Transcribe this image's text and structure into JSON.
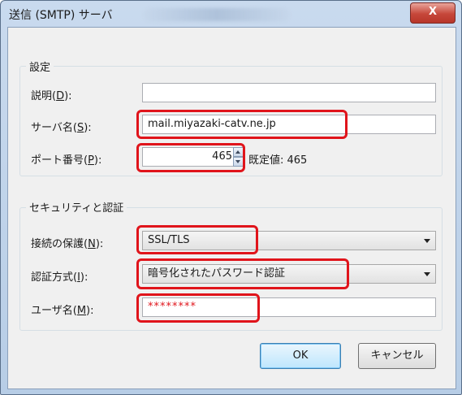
{
  "window": {
    "title": "送信 (SMTP) サーバ",
    "close_label": "X"
  },
  "settings": {
    "group_label": "設定",
    "description": {
      "label": "説明(",
      "mnemonic": "D",
      "suffix": "):",
      "value": ""
    },
    "server": {
      "label": "サーバ名(",
      "mnemonic": "S",
      "suffix": "):",
      "value": "mail.miyazaki-catv.ne.jp"
    },
    "port": {
      "label": "ポート番号(",
      "mnemonic": "P",
      "suffix": "):",
      "value": "465",
      "default_text": "既定値:  465"
    }
  },
  "security": {
    "group_label": "セキュリティと認証",
    "connection": {
      "label": "接続の保護(",
      "mnemonic": "N",
      "suffix": "):",
      "value": "SSL/TLS"
    },
    "auth": {
      "label": "認証方式(",
      "mnemonic": "I",
      "suffix": "):",
      "value": "暗号化されたパスワード認証"
    },
    "username": {
      "label": "ユーザ名(",
      "mnemonic": "M",
      "suffix": "):",
      "value": "********",
      "value_color": "#e0141b"
    }
  },
  "buttons": {
    "ok": "OK",
    "cancel": "キャンセル"
  },
  "highlight_color": "#e0141b"
}
